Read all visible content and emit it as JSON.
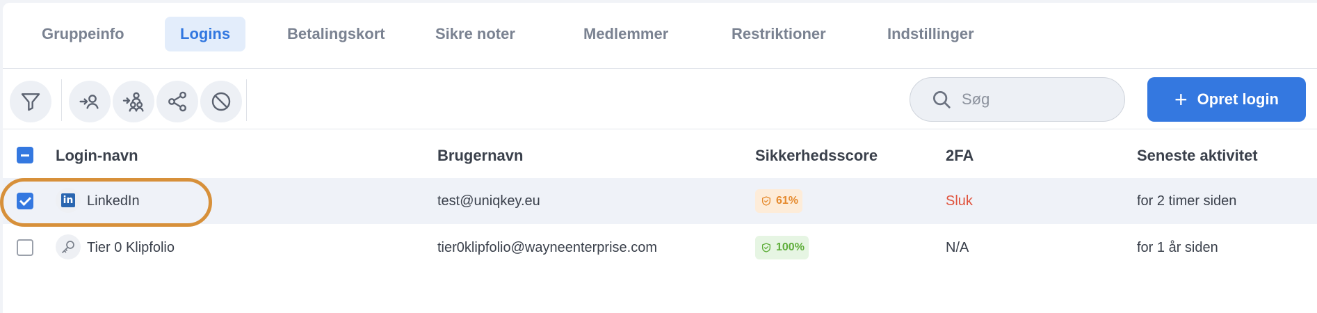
{
  "tabs": [
    {
      "label": "Gruppeinfo",
      "active": false
    },
    {
      "label": "Logins",
      "active": true
    },
    {
      "label": "Betalingskort",
      "active": false
    },
    {
      "label": "Sikre noter",
      "active": false
    },
    {
      "label": "Medlemmer",
      "active": false
    },
    {
      "label": "Restriktioner",
      "active": false
    },
    {
      "label": "Indstillinger",
      "active": false
    }
  ],
  "toolbar": {
    "icons": [
      "filter-icon",
      "assign-user-icon",
      "assign-group-icon",
      "share-icon",
      "block-icon"
    ],
    "search_placeholder": "Søg",
    "create_label": "Opret login"
  },
  "table": {
    "columns": [
      "Login-navn",
      "Brugernavn",
      "Sikkerhedsscore",
      "2FA",
      "Seneste aktivitet"
    ],
    "rows": [
      {
        "name": "LinkedIn",
        "icon": "linkedin-icon",
        "username": "test@uniqkey.eu",
        "score": "61%",
        "twofa": "Sluk",
        "activity": "for 2 timer siden",
        "selected": true
      },
      {
        "name": "Tier 0 Klipfolio",
        "icon": "key-icon",
        "username": "tier0klipfolio@wayneenterprise.com",
        "score": "100%",
        "twofa": "N/A",
        "activity": "for 1 år siden",
        "selected": false
      }
    ]
  },
  "colors": {
    "accent": "#3478e0",
    "active_tab_bg": "#e3edfb",
    "score_mid": "#e58a2e",
    "score_high": "#5fae3b",
    "twofa_off": "#e0533d",
    "highlight": "#d7903a"
  }
}
